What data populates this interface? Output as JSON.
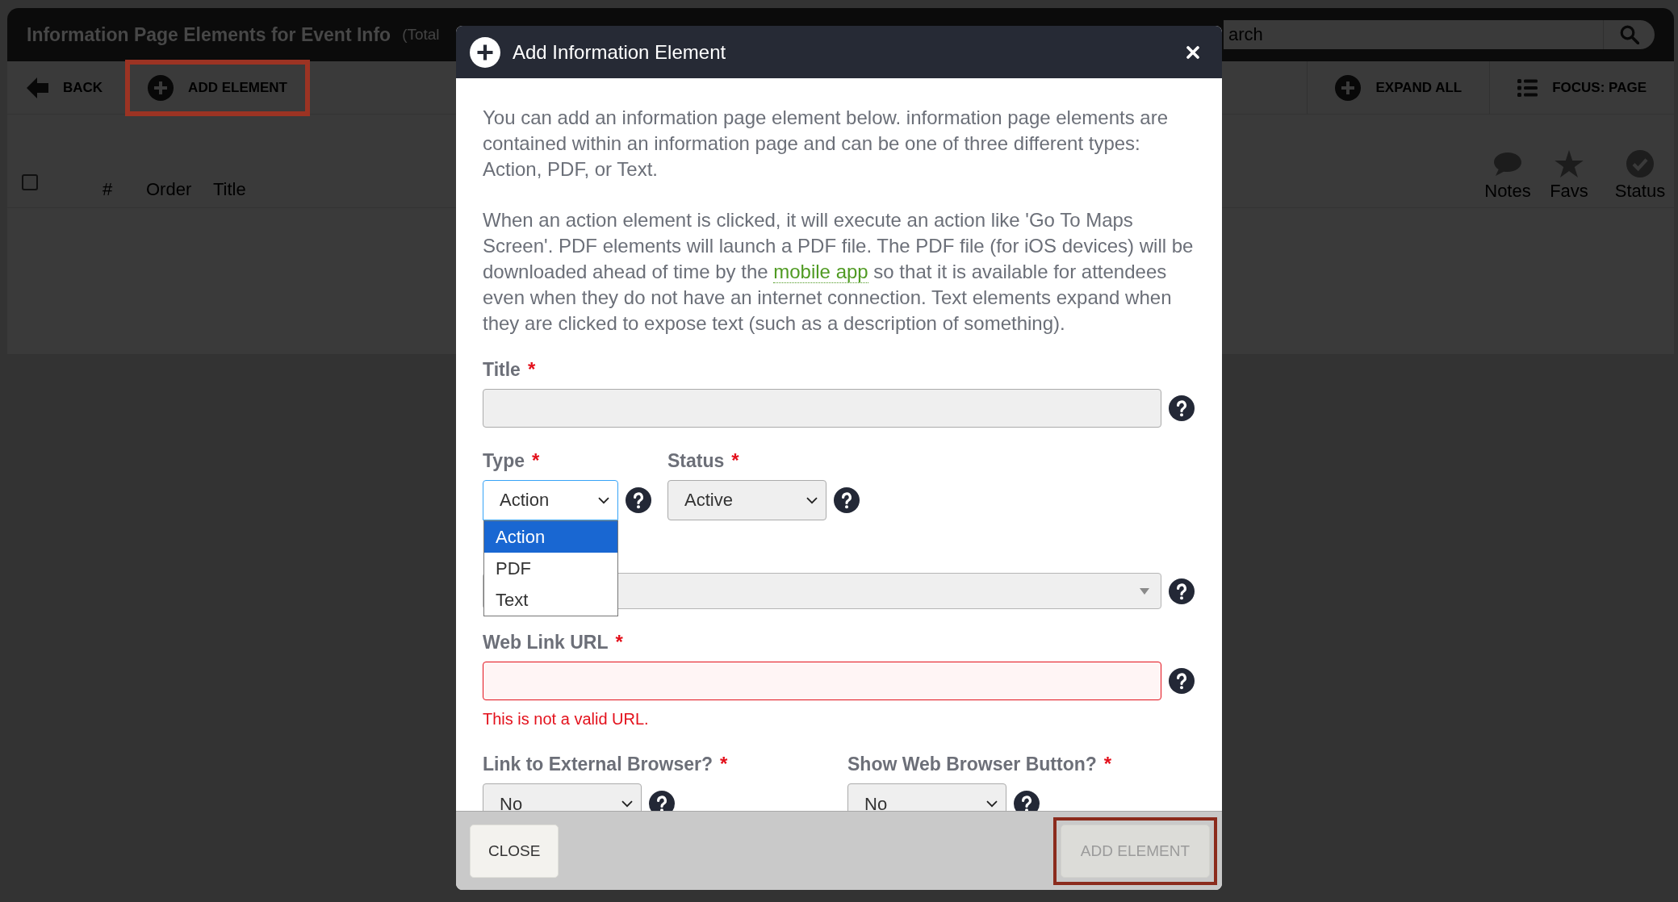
{
  "header": {
    "title": "Information Page Elements for Event Info",
    "count_note": "(Total",
    "search": {
      "placeholder": "arch"
    }
  },
  "toolbar": {
    "left": [
      {
        "kind": "back",
        "label": "BACK",
        "highlighted": false
      },
      {
        "kind": "add",
        "label": "ADD ELEMENT",
        "highlighted": true
      }
    ],
    "right": [
      {
        "kind": "add",
        "label": "EXPAND ALL",
        "highlighted": false
      },
      {
        "kind": "list",
        "label": "FOCUS: PAGE",
        "highlighted": false
      }
    ]
  },
  "table": {
    "select_all": {
      "checked": false
    },
    "columns": [
      "#",
      "Order",
      "Title"
    ],
    "indicator_columns": [
      {
        "kind": "notes",
        "label": "Notes"
      },
      {
        "kind": "favs",
        "label": "Favs"
      },
      {
        "kind": "status",
        "label": "Status"
      }
    ]
  },
  "dialog": {
    "title": "Add Information Element",
    "paragraphs": [
      {
        "segments": [
          {
            "kind": "text",
            "text": "You can add an information page element below. information page elements are contained within an information page and can be one of three different types: Action, PDF, or Text."
          }
        ]
      },
      {
        "segments": [
          {
            "kind": "text",
            "text": "When an action element is clicked, it will execute an action like 'Go To Maps Screen'. PDF elements will launch a PDF file. The PDF file (for iOS devices) will be downloaded ahead of time by the "
          },
          {
            "kind": "link",
            "text": "mobile app"
          },
          {
            "kind": "text",
            "text": " so that it is available for attendees even when they do not have an internet connection. Text elements expand when they are clicked to expose text (such as a description of something)."
          }
        ]
      }
    ],
    "rows": [
      {
        "kind": "single",
        "fields": [
          {
            "kind": "text",
            "label": "Title",
            "required_mark": "*",
            "invalid": false
          }
        ]
      },
      {
        "kind": "inline",
        "fields": [
          {
            "kind": "select",
            "label": "Type",
            "required_mark": "*",
            "value": "Action",
            "focused": true,
            "options": [
              {
                "label": "Action",
                "selected": true
              },
              {
                "label": "PDF",
                "selected": false
              },
              {
                "label": "Text",
                "selected": false
              }
            ]
          },
          {
            "kind": "select",
            "label": "Status",
            "required_mark": "*",
            "value": "Active",
            "focused": false
          }
        ]
      },
      {
        "kind": "single",
        "fields": [
          {
            "kind": "combo"
          }
        ]
      },
      {
        "kind": "single",
        "fields": [
          {
            "kind": "text",
            "label": "Web Link URL",
            "required_mark": "*",
            "invalid": true,
            "error": "This is not a valid URL."
          }
        ]
      },
      {
        "kind": "split",
        "fields": [
          {
            "kind": "select",
            "label": "Link to External Browser?",
            "required_mark": "*",
            "value": "No",
            "focused": false
          },
          {
            "kind": "select",
            "label": "Show Web Browser Button?",
            "required_mark": "*",
            "value": "No",
            "focused": false
          }
        ]
      }
    ],
    "buttons": [
      {
        "label": "CLOSE",
        "disabled": false,
        "highlighted": false
      },
      {
        "label": "ADD ELEMENT",
        "disabled": true,
        "highlighted": true
      }
    ]
  }
}
